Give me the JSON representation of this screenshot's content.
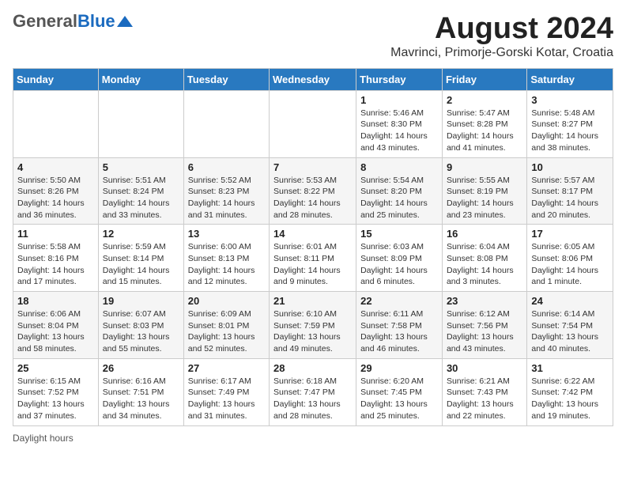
{
  "header": {
    "logo_general": "General",
    "logo_blue": "Blue",
    "title": "August 2024",
    "subtitle": "Mavrinci, Primorje-Gorski Kotar, Croatia"
  },
  "calendar": {
    "days": [
      "Sunday",
      "Monday",
      "Tuesday",
      "Wednesday",
      "Thursday",
      "Friday",
      "Saturday"
    ],
    "weeks": [
      [
        {
          "date": "",
          "info": ""
        },
        {
          "date": "",
          "info": ""
        },
        {
          "date": "",
          "info": ""
        },
        {
          "date": "",
          "info": ""
        },
        {
          "date": "1",
          "info": "Sunrise: 5:46 AM\nSunset: 8:30 PM\nDaylight: 14 hours and 43 minutes."
        },
        {
          "date": "2",
          "info": "Sunrise: 5:47 AM\nSunset: 8:28 PM\nDaylight: 14 hours and 41 minutes."
        },
        {
          "date": "3",
          "info": "Sunrise: 5:48 AM\nSunset: 8:27 PM\nDaylight: 14 hours and 38 minutes."
        }
      ],
      [
        {
          "date": "4",
          "info": "Sunrise: 5:50 AM\nSunset: 8:26 PM\nDaylight: 14 hours and 36 minutes."
        },
        {
          "date": "5",
          "info": "Sunrise: 5:51 AM\nSunset: 8:24 PM\nDaylight: 14 hours and 33 minutes."
        },
        {
          "date": "6",
          "info": "Sunrise: 5:52 AM\nSunset: 8:23 PM\nDaylight: 14 hours and 31 minutes."
        },
        {
          "date": "7",
          "info": "Sunrise: 5:53 AM\nSunset: 8:22 PM\nDaylight: 14 hours and 28 minutes."
        },
        {
          "date": "8",
          "info": "Sunrise: 5:54 AM\nSunset: 8:20 PM\nDaylight: 14 hours and 25 minutes."
        },
        {
          "date": "9",
          "info": "Sunrise: 5:55 AM\nSunset: 8:19 PM\nDaylight: 14 hours and 23 minutes."
        },
        {
          "date": "10",
          "info": "Sunrise: 5:57 AM\nSunset: 8:17 PM\nDaylight: 14 hours and 20 minutes."
        }
      ],
      [
        {
          "date": "11",
          "info": "Sunrise: 5:58 AM\nSunset: 8:16 PM\nDaylight: 14 hours and 17 minutes."
        },
        {
          "date": "12",
          "info": "Sunrise: 5:59 AM\nSunset: 8:14 PM\nDaylight: 14 hours and 15 minutes."
        },
        {
          "date": "13",
          "info": "Sunrise: 6:00 AM\nSunset: 8:13 PM\nDaylight: 14 hours and 12 minutes."
        },
        {
          "date": "14",
          "info": "Sunrise: 6:01 AM\nSunset: 8:11 PM\nDaylight: 14 hours and 9 minutes."
        },
        {
          "date": "15",
          "info": "Sunrise: 6:03 AM\nSunset: 8:09 PM\nDaylight: 14 hours and 6 minutes."
        },
        {
          "date": "16",
          "info": "Sunrise: 6:04 AM\nSunset: 8:08 PM\nDaylight: 14 hours and 3 minutes."
        },
        {
          "date": "17",
          "info": "Sunrise: 6:05 AM\nSunset: 8:06 PM\nDaylight: 14 hours and 1 minute."
        }
      ],
      [
        {
          "date": "18",
          "info": "Sunrise: 6:06 AM\nSunset: 8:04 PM\nDaylight: 13 hours and 58 minutes."
        },
        {
          "date": "19",
          "info": "Sunrise: 6:07 AM\nSunset: 8:03 PM\nDaylight: 13 hours and 55 minutes."
        },
        {
          "date": "20",
          "info": "Sunrise: 6:09 AM\nSunset: 8:01 PM\nDaylight: 13 hours and 52 minutes."
        },
        {
          "date": "21",
          "info": "Sunrise: 6:10 AM\nSunset: 7:59 PM\nDaylight: 13 hours and 49 minutes."
        },
        {
          "date": "22",
          "info": "Sunrise: 6:11 AM\nSunset: 7:58 PM\nDaylight: 13 hours and 46 minutes."
        },
        {
          "date": "23",
          "info": "Sunrise: 6:12 AM\nSunset: 7:56 PM\nDaylight: 13 hours and 43 minutes."
        },
        {
          "date": "24",
          "info": "Sunrise: 6:14 AM\nSunset: 7:54 PM\nDaylight: 13 hours and 40 minutes."
        }
      ],
      [
        {
          "date": "25",
          "info": "Sunrise: 6:15 AM\nSunset: 7:52 PM\nDaylight: 13 hours and 37 minutes."
        },
        {
          "date": "26",
          "info": "Sunrise: 6:16 AM\nSunset: 7:51 PM\nDaylight: 13 hours and 34 minutes."
        },
        {
          "date": "27",
          "info": "Sunrise: 6:17 AM\nSunset: 7:49 PM\nDaylight: 13 hours and 31 minutes."
        },
        {
          "date": "28",
          "info": "Sunrise: 6:18 AM\nSunset: 7:47 PM\nDaylight: 13 hours and 28 minutes."
        },
        {
          "date": "29",
          "info": "Sunrise: 6:20 AM\nSunset: 7:45 PM\nDaylight: 13 hours and 25 minutes."
        },
        {
          "date": "30",
          "info": "Sunrise: 6:21 AM\nSunset: 7:43 PM\nDaylight: 13 hours and 22 minutes."
        },
        {
          "date": "31",
          "info": "Sunrise: 6:22 AM\nSunset: 7:42 PM\nDaylight: 13 hours and 19 minutes."
        }
      ]
    ]
  },
  "footer": {
    "daylight_label": "Daylight hours"
  }
}
